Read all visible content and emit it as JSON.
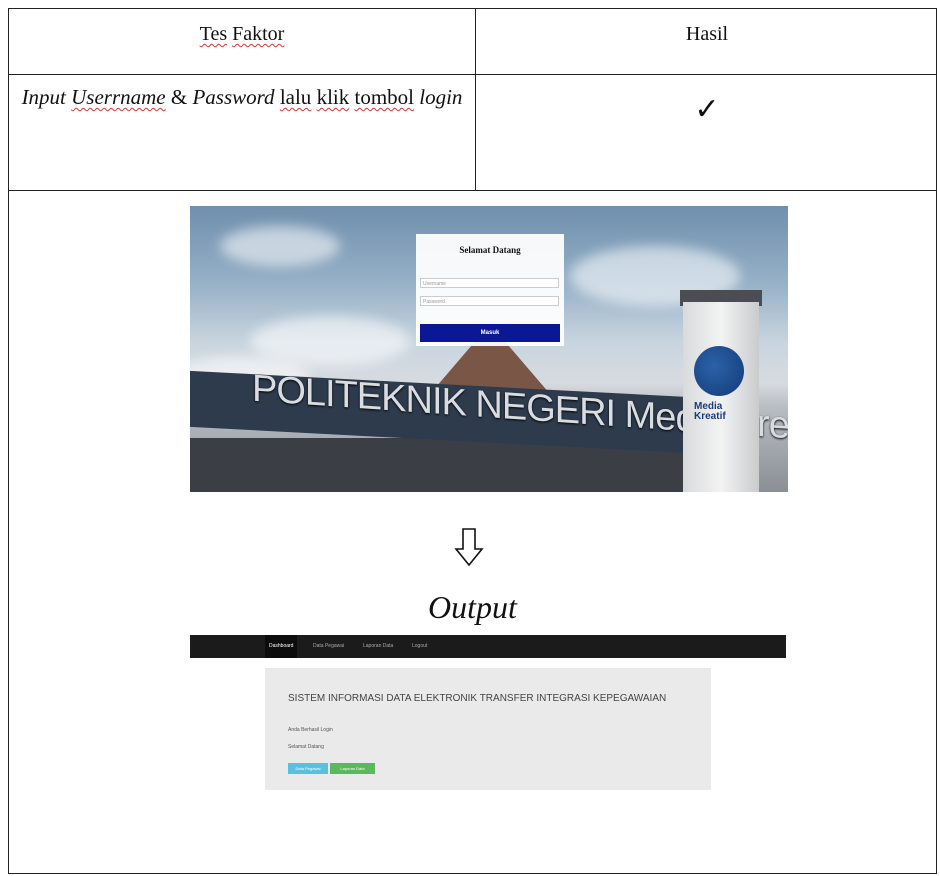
{
  "table": {
    "header": {
      "col1_parts": [
        "Tes",
        " ",
        "Faktor"
      ],
      "col2": "Hasil"
    },
    "test_row": {
      "parts": [
        "Input",
        " ",
        "Userrname",
        " & ",
        "Password",
        " ",
        "lalu",
        " ",
        "klik",
        " ",
        "tombol",
        " ",
        "login"
      ],
      "result": "✓"
    },
    "output_label": "Output",
    "arrow_icon": "down-arrow-outline-icon"
  },
  "login_screenshot": {
    "title": "Selamat Datang",
    "username_placeholder": "Username",
    "password_placeholder": "Password",
    "button": "Masuk",
    "gate_text": "POLITEKNIK NEGERI Media Kreatif",
    "pillar_brand": "Media Kreatif",
    "button_color": "#0a1896"
  },
  "dashboard_screenshot": {
    "nav_items": [
      "Dashboard",
      "Data Pegawai",
      "Laporan Data",
      "Logout"
    ],
    "title": "SISTEM INFORMASI DATA ELEKTRONIK TRANSFER INTEGRASI KEPEGAWAIAN",
    "line1": "Anda Berhasil Login",
    "line2": "Selamat Datang",
    "btn1": "Data Pegawai",
    "btn2": "Laporan Data",
    "nav_color": "#1b1b1b",
    "btn1_color": "#5bc0de",
    "btn2_color": "#5cb85c"
  }
}
